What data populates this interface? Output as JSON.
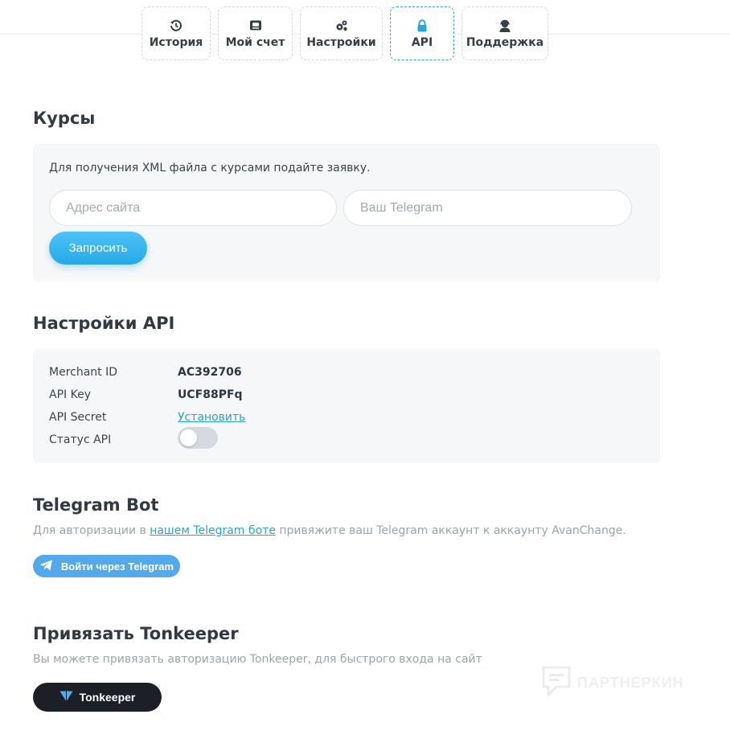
{
  "tabs": [
    {
      "label": "История",
      "icon": "history-icon"
    },
    {
      "label": "Мой счет",
      "icon": "wallet-icon"
    },
    {
      "label": "Настройки",
      "icon": "settings-icon"
    },
    {
      "label": "API",
      "icon": "lock-icon"
    },
    {
      "label": "Поддержка",
      "icon": "support-agent-icon"
    }
  ],
  "rates": {
    "title": "Курсы",
    "description": "Для получения XML файла с курсами подайте заявку.",
    "site_placeholder": "Адрес сайта",
    "telegram_placeholder": "Ваш Telegram",
    "request_button": "Запросить"
  },
  "api_settings": {
    "title": "Настройки API",
    "merchant_id_label": "Merchant ID",
    "merchant_id_value": "AC392706",
    "api_key_label": "API Key",
    "api_key_value": "UCF88PFq",
    "api_secret_label": "API Secret",
    "api_secret_link": "Установить",
    "api_status_label": "Статус API",
    "api_status_enabled": false
  },
  "telegram_bot": {
    "title": "Telegram Bot",
    "text_before": "Для авторизации в ",
    "link_text": "нашем Telegram боте",
    "text_after": " привяжите ваш Telegram аккаунт к аккаунту AvanChange.",
    "login_button": "Войти через Telegram"
  },
  "tonkeeper": {
    "title": "Привязать Tonkeeper",
    "description": "Вы можете привязать авторизацию Tonkeeper, для быстрого входа на сайт",
    "button": "Tonkeeper"
  },
  "watermark": {
    "text": "ПАРТНЕРКИН"
  },
  "colors": {
    "accent": "#2aa3c8",
    "request_button": "#25a9e6",
    "telegram_button": "#54a9eb",
    "tonkeeper_button": "#1c1f26",
    "panel_bg": "#f6f7f9"
  }
}
